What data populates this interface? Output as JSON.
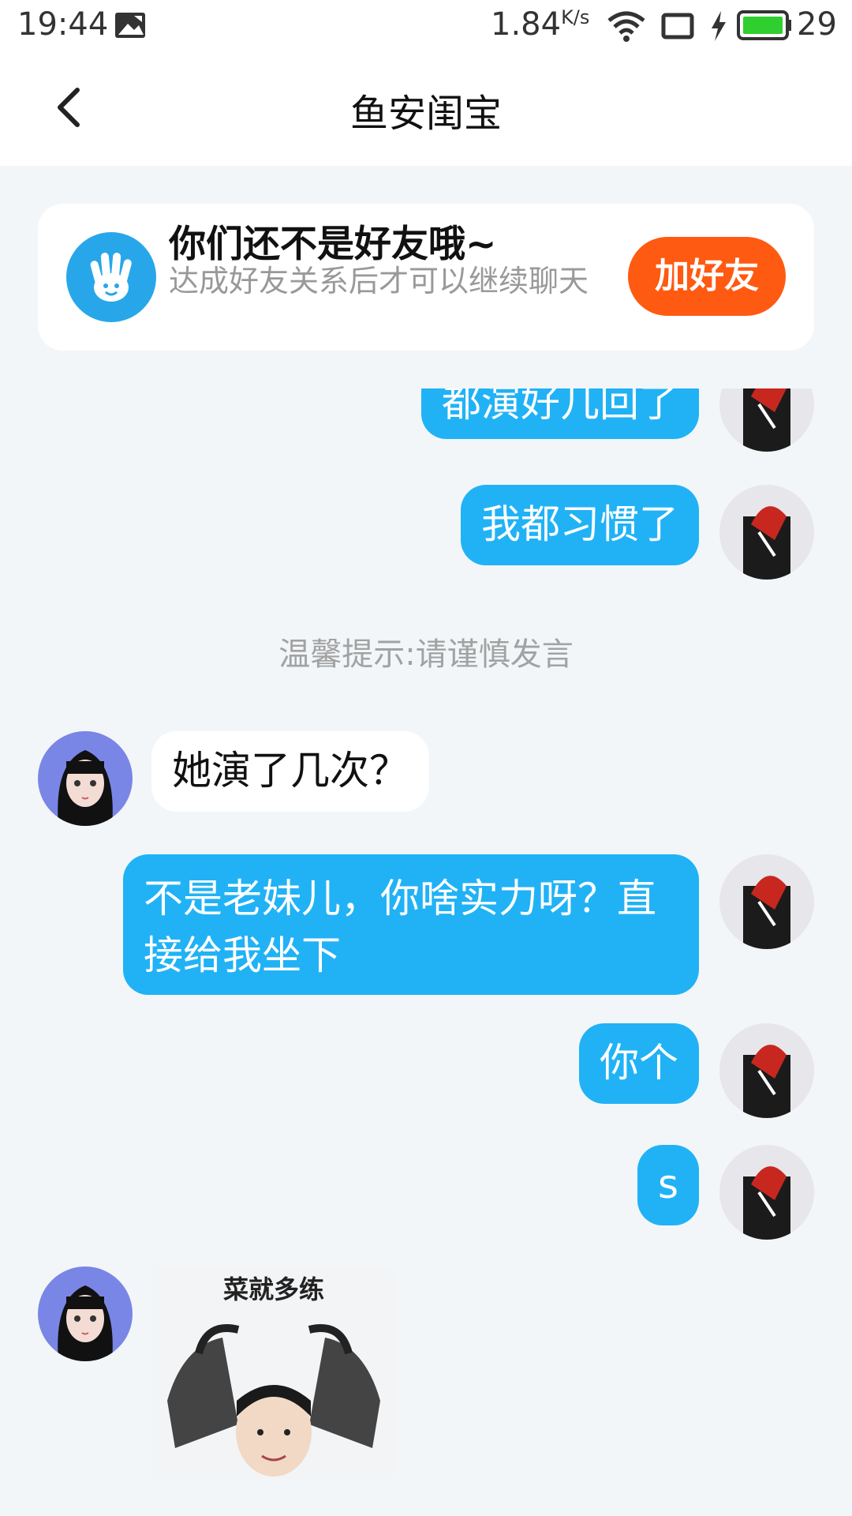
{
  "status_bar": {
    "time": "19:44",
    "net_speed": "1.84",
    "net_unit": "K/s",
    "battery": "29",
    "icons": [
      "image-icon",
      "wifi-icon",
      "sim-icon",
      "charging-icon",
      "battery-icon"
    ]
  },
  "nav": {
    "back_icon": "chevron-left-icon",
    "title": "鱼安闺宝"
  },
  "banner": {
    "title": "你们还不是好友哦~",
    "subtitle": "达成好友关系后才可以继续聊天",
    "button": "加好友",
    "icon": "wave-hand-icon"
  },
  "messages": [
    {
      "side": "right",
      "text": "都演好几回了"
    },
    {
      "side": "right",
      "text": "我都习惯了"
    },
    {
      "side": "left",
      "text": "她演了几次？"
    },
    {
      "side": "right",
      "text": "不是老妹儿，你啥实力呀？直接给我坐下"
    },
    {
      "side": "right",
      "text": "你个"
    },
    {
      "side": "right",
      "text": "s"
    }
  ],
  "notice": "温馨提示:请谨慎发言",
  "sticker": {
    "caption": "菜就多练"
  },
  "colors": {
    "bubble_out": "#21b2f6",
    "add_button": "#ff5a11",
    "background": "#f2f6f9"
  }
}
